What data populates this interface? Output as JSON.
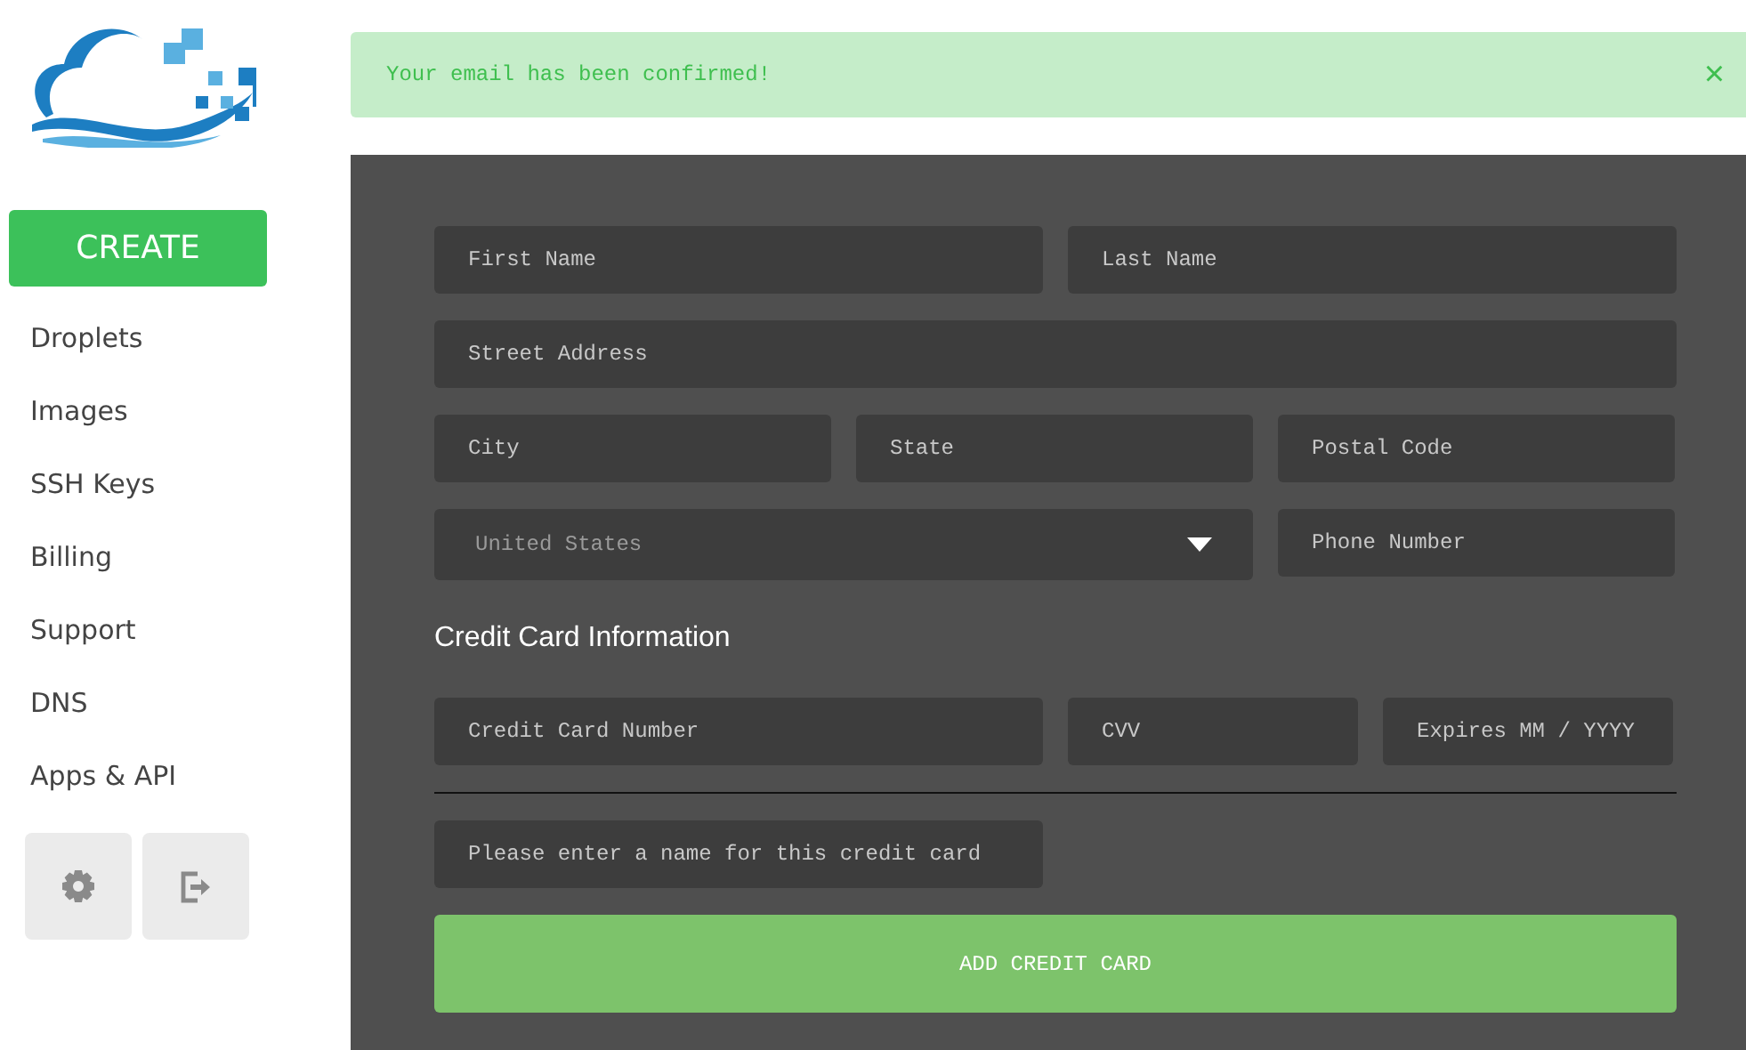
{
  "sidebar": {
    "create_button": "CREATE",
    "nav": [
      {
        "label": "Droplets"
      },
      {
        "label": "Images"
      },
      {
        "label": "SSH Keys"
      },
      {
        "label": "Billing"
      },
      {
        "label": "Support"
      },
      {
        "label": "DNS"
      },
      {
        "label": "Apps & API"
      }
    ]
  },
  "alert": {
    "message": "Your email has been confirmed!",
    "close": "×"
  },
  "form": {
    "first_name": {
      "placeholder": "First Name"
    },
    "last_name": {
      "placeholder": "Last Name"
    },
    "street": {
      "placeholder": "Street Address"
    },
    "city": {
      "placeholder": "City"
    },
    "state": {
      "placeholder": "State"
    },
    "postal_code": {
      "placeholder": "Postal Code"
    },
    "country": {
      "value": "United States"
    },
    "phone": {
      "placeholder": "Phone Number"
    },
    "card_heading": "Credit Card Information",
    "card_number": {
      "placeholder": "Credit Card Number"
    },
    "cvv": {
      "placeholder": "CVV"
    },
    "expires": {
      "placeholder": "Expires MM / YYYY"
    },
    "card_name": {
      "placeholder": "Please enter a name for this credit card"
    },
    "submit": "ADD CREDIT CARD"
  }
}
